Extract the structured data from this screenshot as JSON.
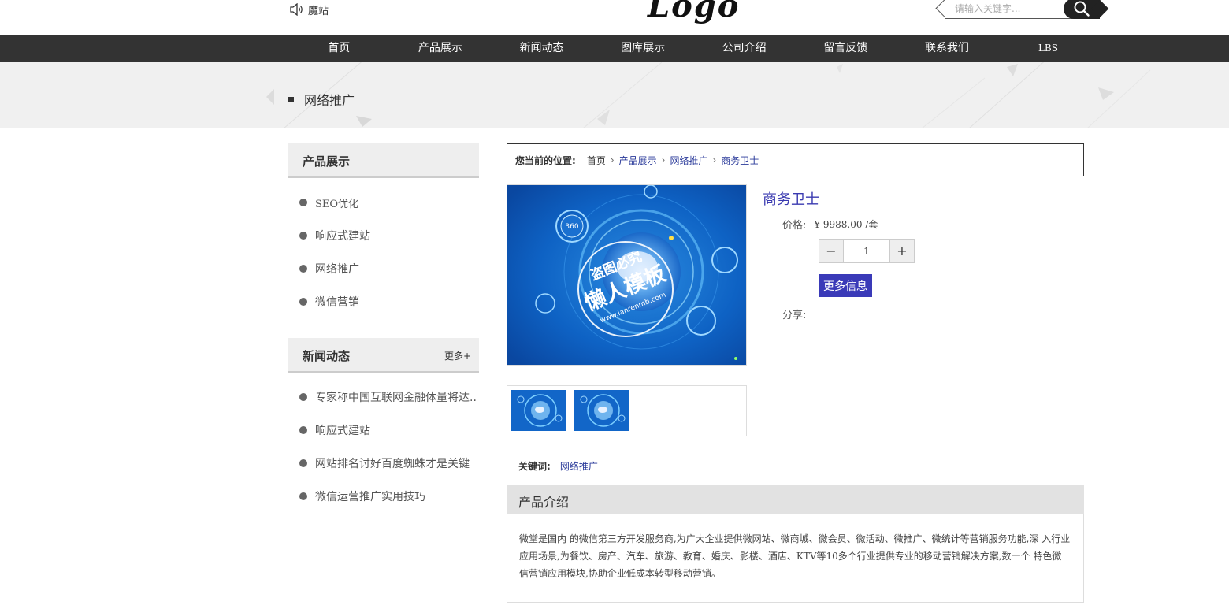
{
  "header": {
    "notice": "魔站",
    "logo_text": "Logo",
    "search": {
      "placeholder": "请输入关键字..."
    }
  },
  "nav": {
    "items": [
      {
        "label": "首页"
      },
      {
        "label": "产品展示"
      },
      {
        "label": "新闻动态"
      },
      {
        "label": "图库展示"
      },
      {
        "label": "公司介绍"
      },
      {
        "label": "留言反馈"
      },
      {
        "label": "联系我们"
      },
      {
        "label": "LBS"
      }
    ]
  },
  "banner": {
    "title": "网络推广"
  },
  "sidebar": {
    "products": {
      "title": "产品展示",
      "items": [
        {
          "label": "SEO优化"
        },
        {
          "label": "响应式建站"
        },
        {
          "label": "网络推广"
        },
        {
          "label": "微信营销"
        }
      ]
    },
    "news": {
      "title": "新闻动态",
      "more": "更多+",
      "items": [
        {
          "label": "专家称中国互联网金融体量将达.."
        },
        {
          "label": "响应式建站"
        },
        {
          "label": "网站排名讨好百度蜘蛛才是关键"
        },
        {
          "label": "微信运营推广实用技巧"
        }
      ]
    }
  },
  "breadcrumb": {
    "label": "您当前的位置:",
    "items": [
      {
        "label": "首页"
      },
      {
        "label": "产品展示"
      },
      {
        "label": "网络推广"
      },
      {
        "label": "商务卫士"
      }
    ]
  },
  "product": {
    "name": "商务卫士",
    "price_label": "价格:",
    "price_value": "¥ 9988.00 /套",
    "quantity": "1",
    "more_button": "更多信息",
    "share_label": "分享:",
    "image_watermark": {
      "line1": "盗图必究",
      "line2": "懒人模板",
      "line3": "www.lanrenmb.com"
    },
    "image_badge": "360"
  },
  "keywords": {
    "label": "关键词:",
    "value": "网络推广"
  },
  "intro": {
    "title": "产品介绍",
    "text": "微堂是国内 的微信第三方开发服务商,为广大企业提供微网站、微商城、微会员、微活动、微推广、微统计等营销服务功能,深 入行业应用场景,为餐饮、房产、汽车、旅游、教育、婚庆、影楼、酒店、KTV等10多个行业提供专业的移动营销解决方案,数十个 特色微信营销应用模块,协助企业低成本转型移动营销。"
  },
  "colors": {
    "nav_bg": "#333333",
    "accent_blue": "#3a3ab8",
    "link_blue": "#2a3a9a",
    "banner_bg": "#f0f0f0"
  }
}
